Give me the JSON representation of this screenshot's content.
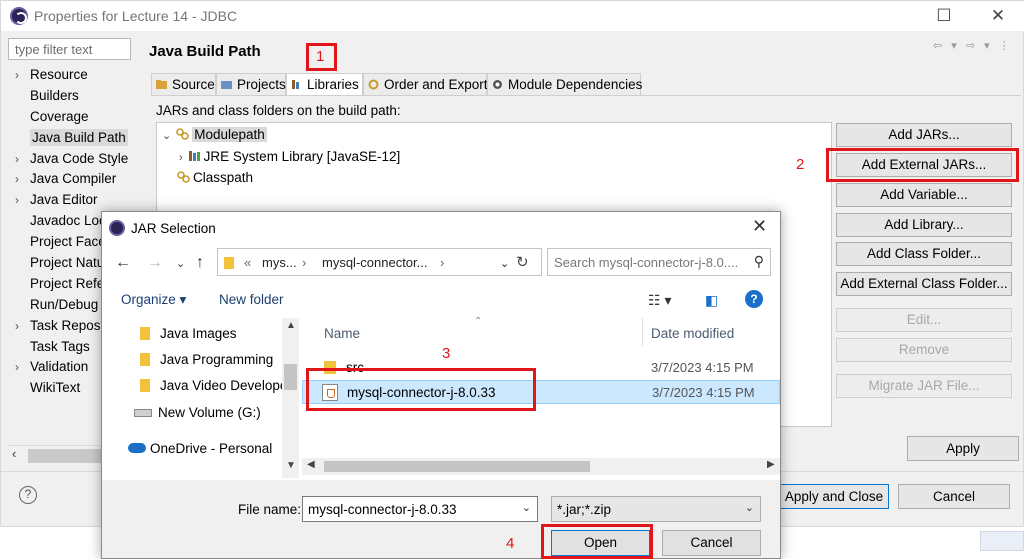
{
  "window": {
    "title": "Properties for Lecture 14 - JDBC",
    "filter_placeholder": "type filter text",
    "nav_items": [
      {
        "label": "Resource",
        "expandable": true
      },
      {
        "label": "Builders",
        "expandable": false
      },
      {
        "label": "Coverage",
        "expandable": false
      },
      {
        "label": "Java Build Path",
        "expandable": false,
        "selected": true
      },
      {
        "label": "Java Code Style",
        "expandable": true
      },
      {
        "label": "Java Compiler",
        "expandable": true
      },
      {
        "label": "Java Editor",
        "expandable": true
      },
      {
        "label": "Javadoc Loc",
        "expandable": false
      },
      {
        "label": "Project Facet",
        "expandable": false
      },
      {
        "label": "Project Natu",
        "expandable": false
      },
      {
        "label": "Project Refer",
        "expandable": false
      },
      {
        "label": "Run/Debug",
        "expandable": false
      },
      {
        "label": "Task Reposit",
        "expandable": true
      },
      {
        "label": "Task Tags",
        "expandable": false
      },
      {
        "label": "Validation",
        "expandable": true
      },
      {
        "label": "WikiText",
        "expandable": false
      }
    ]
  },
  "pane": {
    "title": "Java Build Path",
    "tabs": [
      "Source",
      "Projects",
      "Libraries",
      "Order and Export",
      "Module Dependencies"
    ],
    "active_tab": "Libraries",
    "subtitle": "JARs and class folders on the build path:",
    "tree": {
      "modulepath": "Modulepath",
      "jre": "JRE System Library [JavaSE-12]",
      "classpath": "Classpath"
    },
    "buttons": [
      {
        "label": "Add JARs...",
        "enabled": true
      },
      {
        "label": "Add External JARs...",
        "enabled": true
      },
      {
        "label": "Add Variable...",
        "enabled": true
      },
      {
        "label": "Add Library...",
        "enabled": true
      },
      {
        "label": "Add Class Folder...",
        "enabled": true
      },
      {
        "label": "Add External Class Folder...",
        "enabled": true
      },
      {
        "label": "Edit...",
        "enabled": false
      },
      {
        "label": "Remove",
        "enabled": false
      },
      {
        "label": "Migrate JAR File...",
        "enabled": false
      }
    ],
    "apply_label": "Apply",
    "apply_close_label": "Apply and Close",
    "cancel_label": "Cancel"
  },
  "dialog": {
    "title": "JAR Selection",
    "breadcrumb": [
      "mys...",
      "mysql-connector..."
    ],
    "search_placeholder": "Search mysql-connector-j-8.0....",
    "organize_label": "Organize",
    "new_folder_label": "New folder",
    "left_nav": [
      "Java Images",
      "Java Programming",
      "Java Video Develope",
      "New Volume (G:)",
      "OneDrive - Personal"
    ],
    "columns": {
      "name": "Name",
      "date": "Date modified"
    },
    "files": [
      {
        "name": "src",
        "date": "3/7/2023 4:15 PM",
        "type": "folder"
      },
      {
        "name": "mysql-connector-j-8.0.33",
        "date": "3/7/2023 4:15 PM",
        "type": "jar",
        "selected": true
      }
    ],
    "file_name_label": "File name:",
    "file_name_value": "mysql-connector-j-8.0.33",
    "filter_value": "*.jar;*.zip",
    "open_label": "Open",
    "cancel_label": "Cancel"
  },
  "annotations": [
    "1",
    "2",
    "3",
    "4"
  ],
  "colors": {
    "annotation": "#e0161a",
    "selection": "#cce8ff",
    "accent": "#0078d7"
  }
}
